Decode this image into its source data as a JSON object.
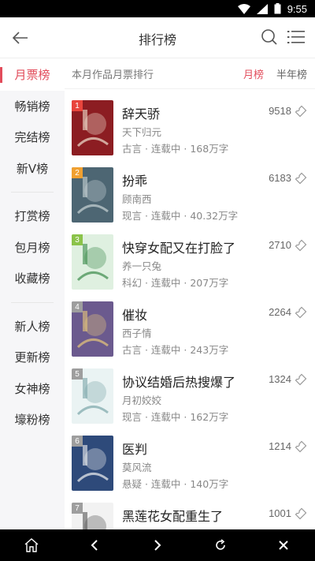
{
  "status": {
    "time": "9:55"
  },
  "header": {
    "title": "排行榜"
  },
  "sidebar": {
    "group1": [
      "月票榜",
      "畅销榜",
      "完结榜",
      "新V榜"
    ],
    "group2": [
      "打赏榜",
      "包月榜",
      "收藏榜"
    ],
    "group3": [
      "新人榜",
      "更新榜",
      "女神榜",
      "壕粉榜"
    ]
  },
  "main": {
    "subtitle": "本月作品月票排行",
    "tabs": [
      "月榜",
      "半年榜"
    ]
  },
  "books": [
    {
      "rank": "1",
      "title": "辞天骄",
      "author": "天下归元",
      "meta": "古言 · 连载中 · 168万字",
      "votes": "9518",
      "rank_color": "#e8453c",
      "cover_bg": "#8c1d22",
      "cover_fg": "#f0e2d0"
    },
    {
      "rank": "2",
      "title": "扮乖",
      "author": "顾南西",
      "meta": "现言 · 连载中 · 40.32万字",
      "votes": "6183",
      "rank_color": "#f0a030",
      "cover_bg": "#4d6673",
      "cover_fg": "#c9d4d6"
    },
    {
      "rank": "3",
      "title": "快穿女配又在打脸了",
      "author": "养一只兔",
      "meta": "科幻 · 连载中 · 207万字",
      "votes": "2710",
      "rank_color": "#8bc34a",
      "cover_bg": "#dff0e0",
      "cover_fg": "#3b8a4a"
    },
    {
      "rank": "4",
      "title": "催妆",
      "author": "西子情",
      "meta": "古言 · 连载中 · 243万字",
      "votes": "2264",
      "rank_color": "#9e9e9e",
      "cover_bg": "#6b5a8e",
      "cover_fg": "#e8c87a"
    },
    {
      "rank": "5",
      "title": "协议结婚后热搜爆了",
      "author": "月初姣姣",
      "meta": "现言 · 连载中 · 162万字",
      "votes": "1324",
      "rank_color": "#9e9e9e",
      "cover_bg": "#eaf3f3",
      "cover_fg": "#7aa5a8"
    },
    {
      "rank": "6",
      "title": "医判",
      "author": "莫风流",
      "meta": "悬疑 · 连载中 · 140万字",
      "votes": "1214",
      "rank_color": "#9e9e9e",
      "cover_bg": "#2e4a7a",
      "cover_fg": "#f2f2f2"
    },
    {
      "rank": "7",
      "title": "黑莲花女配重生了",
      "author": "",
      "meta": "",
      "votes": "1001",
      "rank_color": "#9e9e9e",
      "cover_bg": "#f2f2f2",
      "cover_fg": "#555"
    }
  ],
  "colors": {
    "accent": "#e24c5b"
  }
}
